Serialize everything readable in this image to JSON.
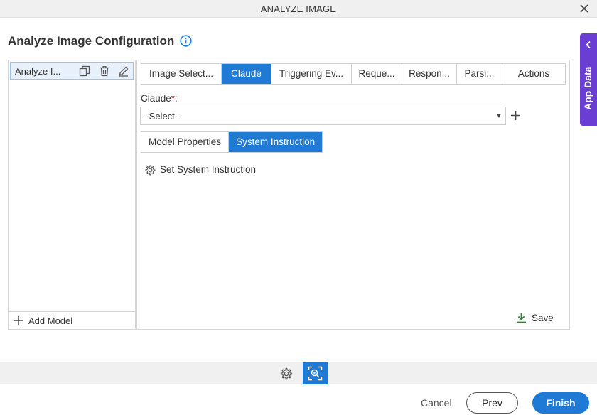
{
  "window": {
    "title": "ANALYZE IMAGE"
  },
  "page": {
    "title": "Analyze Image Configuration"
  },
  "left_panel": {
    "models": [
      {
        "label": "Analyze I..."
      }
    ],
    "add_model_label": "Add Model"
  },
  "tabs": [
    {
      "label": "Image Select...",
      "active": false
    },
    {
      "label": "Claude",
      "active": true
    },
    {
      "label": "Triggering Ev...",
      "active": false
    },
    {
      "label": "Reque...",
      "active": false
    },
    {
      "label": "Respon...",
      "active": false
    },
    {
      "label": "Parsi...",
      "active": false
    },
    {
      "label": "Actions",
      "active": false
    }
  ],
  "claude_field": {
    "label": "Claude",
    "required_mark": "*",
    "colon": ":",
    "selected": "--Select--"
  },
  "sub_tabs": [
    {
      "label": "Model Properties",
      "active": false
    },
    {
      "label": "System Instruction",
      "active": true
    }
  ],
  "system_instruction": {
    "link_label": "Set System Instruction"
  },
  "save_label": "Save",
  "side_panel": {
    "label": "App Data"
  },
  "footer": {
    "cancel_label": "Cancel",
    "prev_label": "Prev",
    "finish_label": "Finish"
  },
  "colors": {
    "accent": "#1f7ad6",
    "side_tab": "#6a3dd3",
    "required": "#d9342b",
    "save_icon": "#2e7d32"
  }
}
